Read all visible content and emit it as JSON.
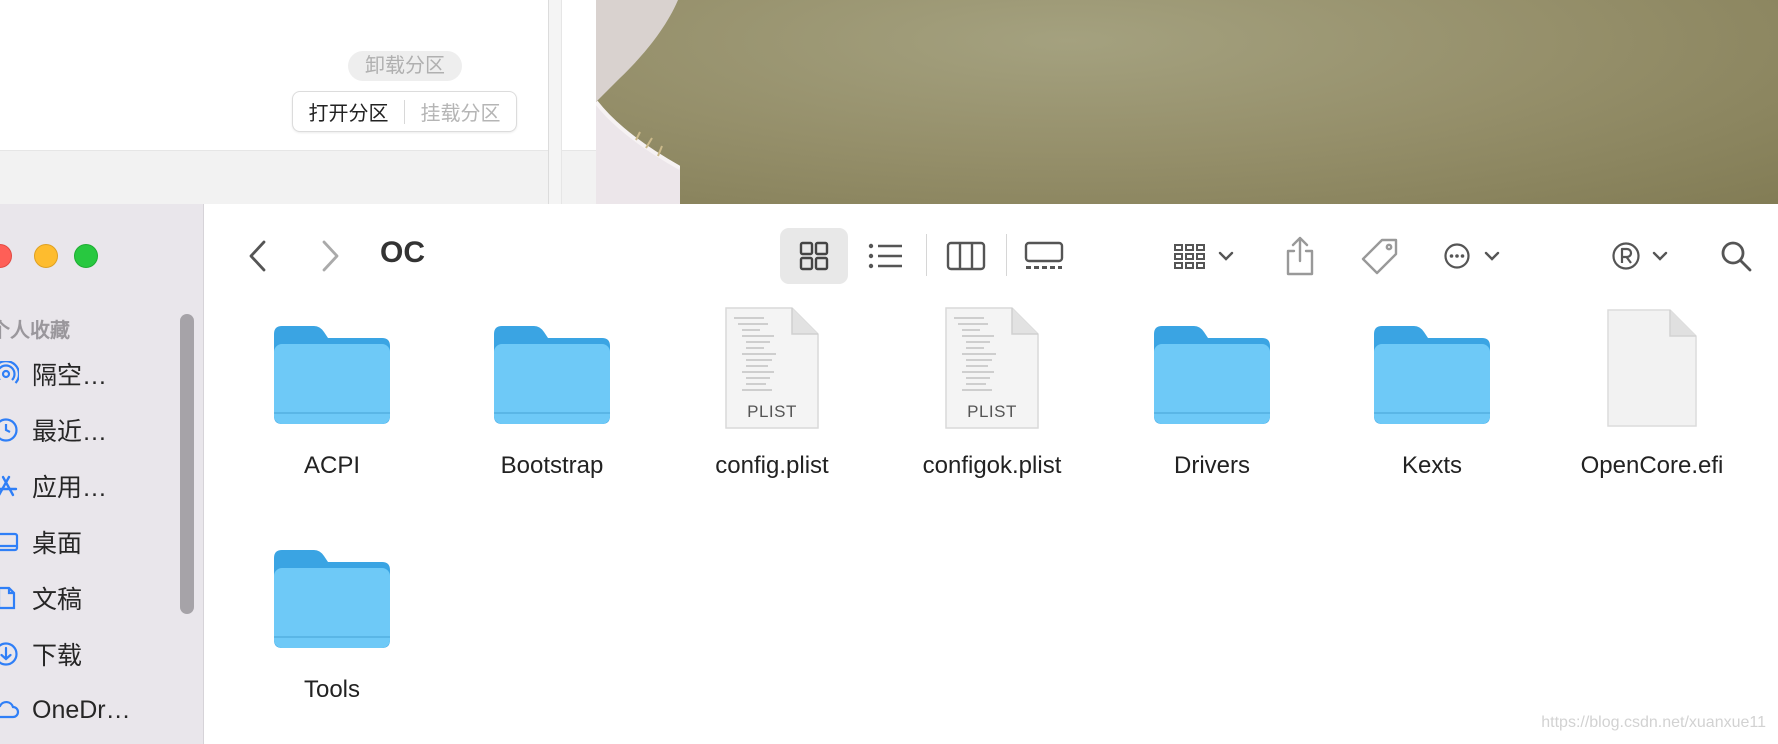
{
  "disk_utility": {
    "unmount_label": "卸载分区",
    "open_label": "打开分区",
    "mount_label": "挂载分区"
  },
  "finder": {
    "title": "OC",
    "sidebar": {
      "section_title": "个人收藏",
      "items": [
        {
          "label": "隔空…",
          "icon": "airdrop-icon"
        },
        {
          "label": "最近…",
          "icon": "clock-icon"
        },
        {
          "label": "应用…",
          "icon": "applications-icon"
        },
        {
          "label": "桌面",
          "icon": "desktop-icon"
        },
        {
          "label": "文稿",
          "icon": "document-icon"
        },
        {
          "label": "下载",
          "icon": "download-icon"
        },
        {
          "label": "OneDr…",
          "icon": "cloud-icon"
        }
      ]
    },
    "toolbar": {
      "icons": [
        "back-icon",
        "forward-icon",
        "icon-view-icon",
        "list-view-icon",
        "column-view-icon",
        "gallery-view-icon",
        "group-icon",
        "share-icon",
        "tag-icon",
        "more-icon",
        "registered-icon",
        "search-icon"
      ]
    },
    "files": [
      {
        "name": "ACPI",
        "type": "folder"
      },
      {
        "name": "Bootstrap",
        "type": "folder"
      },
      {
        "name": "config.plist",
        "type": "plist",
        "tag": "PLIST"
      },
      {
        "name": "configok.plist",
        "type": "plist",
        "tag": "PLIST"
      },
      {
        "name": "Drivers",
        "type": "folder"
      },
      {
        "name": "Kexts",
        "type": "folder"
      },
      {
        "name": "OpenCore.efi",
        "type": "file"
      },
      {
        "name": "Tools",
        "type": "folder"
      }
    ]
  },
  "watermark": "https://blog.csdn.net/xuanxue11",
  "colors": {
    "folder_body": "#6ec9f7",
    "folder_tab": "#3aa4e3",
    "sidebar_bg": "#e9e6eb",
    "accent": "#2f7ff7"
  }
}
